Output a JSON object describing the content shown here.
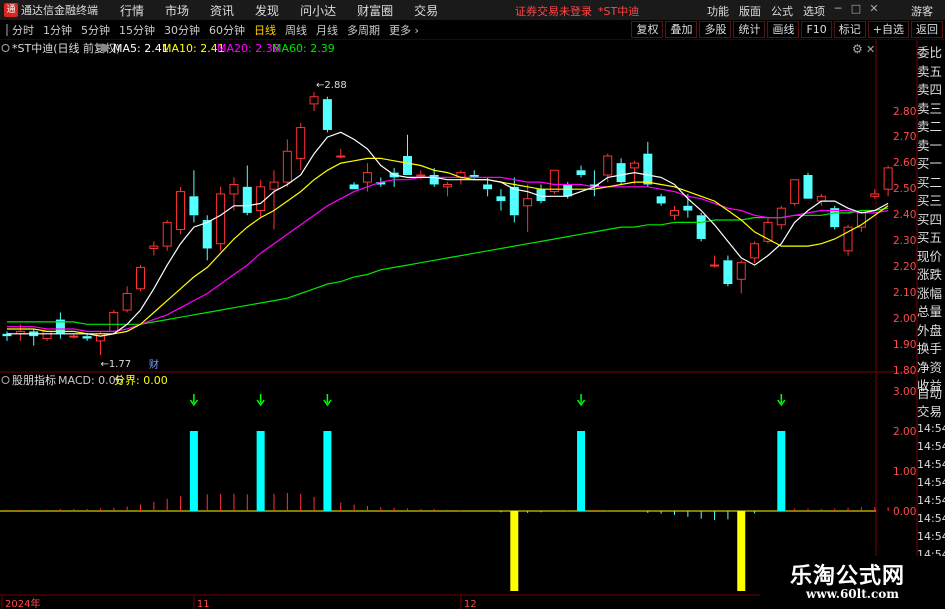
{
  "app": {
    "name": "通达信金融终端",
    "logo_char": "通"
  },
  "menu": [
    "行情",
    "市场",
    "资讯",
    "发现",
    "问小达",
    "财富圈",
    "交易"
  ],
  "login_warning": {
    "text": "证券交易未登录",
    "stock": "*ST中迪"
  },
  "right_menu": [
    "功能",
    "版面",
    "公式",
    "选项"
  ],
  "guest_label": "游客",
  "periods": [
    {
      "label": "分时",
      "active": false
    },
    {
      "label": "1分钟",
      "active": false
    },
    {
      "label": "5分钟",
      "active": false
    },
    {
      "label": "15分钟",
      "active": false
    },
    {
      "label": "30分钟",
      "active": false
    },
    {
      "label": "60分钟",
      "active": false
    },
    {
      "label": "日线",
      "active": true
    },
    {
      "label": "周线",
      "active": false
    },
    {
      "label": "月线",
      "active": false
    },
    {
      "label": "多周期",
      "active": false
    },
    {
      "label": "更多",
      "active": false
    }
  ],
  "tools": [
    "复权",
    "叠加",
    "多股",
    "统计",
    "画线",
    "F10",
    "标记",
    "+自选",
    "返回"
  ],
  "side_panel": [
    "委比",
    "卖五",
    "卖四",
    "卖三",
    "卖二",
    "卖一",
    "买一",
    "买二",
    "买三",
    "买四",
    "买五",
    "现价",
    "涨跌",
    "涨幅",
    "总量",
    "外盘",
    "换手",
    "净资",
    "收益"
  ],
  "auto_trade": [
    "自动",
    "交易"
  ],
  "watermark": {
    "title": "乐淘公式网",
    "url": "www.60lt.com"
  },
  "colors": {
    "up": "#ff3232",
    "down": "#54ffff",
    "ma5": "#ffffff",
    "ma10": "#ffff00",
    "ma20": "#ff00ff",
    "ma60": "#00e600",
    "macd_pos": "#00ffff",
    "macd_neg": "#ffff00",
    "frame": "#7a0000",
    "arrow": "#00ff00"
  },
  "chart_data": [
    {
      "type": "candlestick",
      "title": "*ST中迪(日线 前复权)",
      "ma_legend": [
        {
          "label": "MA5: 2.41",
          "color": "#ffffff"
        },
        {
          "label": "MA10: 2.41",
          "color": "#ffff00"
        },
        {
          "label": "MA20: 2.38",
          "color": "#ff00ff"
        },
        {
          "label": "MA60: 2.39",
          "color": "#00e600"
        }
      ],
      "ylim": [
        1.75,
        2.95
      ],
      "y_ticks": [
        "2.80",
        "2.70",
        "2.60",
        "2.50",
        "2.40",
        "2.30",
        "2.20",
        "2.10",
        "2.00",
        "1.90",
        "1.80"
      ],
      "annotations": [
        {
          "text": "2.88",
          "index": 23,
          "price": 2.88
        },
        {
          "text": "1.77",
          "index": 7,
          "price": 1.83
        },
        {
          "text": "财",
          "index": 11,
          "price": 1.8
        }
      ],
      "x_labels": [
        {
          "text": "2024年",
          "index": 0
        },
        {
          "text": "11",
          "index": 14
        },
        {
          "text": "12",
          "index": 34
        }
      ],
      "candles": [
        {
          "o": 1.86,
          "h": 1.87,
          "l": 1.83,
          "c": 1.85
        },
        {
          "o": 1.86,
          "h": 1.9,
          "l": 1.83,
          "c": 1.87
        },
        {
          "o": 1.87,
          "h": 1.88,
          "l": 1.81,
          "c": 1.85
        },
        {
          "o": 1.84,
          "h": 1.87,
          "l": 1.83,
          "c": 1.87
        },
        {
          "o": 1.92,
          "h": 1.95,
          "l": 1.84,
          "c": 1.86
        },
        {
          "o": 1.85,
          "h": 1.86,
          "l": 1.84,
          "c": 1.85
        },
        {
          "o": 1.85,
          "h": 1.86,
          "l": 1.83,
          "c": 1.84
        },
        {
          "o": 1.83,
          "h": 1.87,
          "l": 1.77,
          "c": 1.86
        },
        {
          "o": 1.87,
          "h": 1.96,
          "l": 1.86,
          "c": 1.95
        },
        {
          "o": 1.96,
          "h": 2.06,
          "l": 1.95,
          "c": 2.03
        },
        {
          "o": 2.05,
          "h": 2.15,
          "l": 2.04,
          "c": 2.14
        },
        {
          "o": 2.22,
          "h": 2.25,
          "l": 2.19,
          "c": 2.23
        },
        {
          "o": 2.23,
          "h": 2.34,
          "l": 2.21,
          "c": 2.33
        },
        {
          "o": 2.3,
          "h": 2.48,
          "l": 2.28,
          "c": 2.46
        },
        {
          "o": 2.44,
          "h": 2.55,
          "l": 2.33,
          "c": 2.36
        },
        {
          "o": 2.34,
          "h": 2.36,
          "l": 2.17,
          "c": 2.22
        },
        {
          "o": 2.24,
          "h": 2.48,
          "l": 2.21,
          "c": 2.45
        },
        {
          "o": 2.45,
          "h": 2.52,
          "l": 2.38,
          "c": 2.49
        },
        {
          "o": 2.48,
          "h": 2.57,
          "l": 2.36,
          "c": 2.37
        },
        {
          "o": 2.38,
          "h": 2.51,
          "l": 2.35,
          "c": 2.48
        },
        {
          "o": 2.47,
          "h": 2.55,
          "l": 2.3,
          "c": 2.5
        },
        {
          "o": 2.5,
          "h": 2.68,
          "l": 2.48,
          "c": 2.63
        },
        {
          "o": 2.6,
          "h": 2.75,
          "l": 2.55,
          "c": 2.73
        },
        {
          "o": 2.83,
          "h": 2.88,
          "l": 2.8,
          "c": 2.86
        },
        {
          "o": 2.85,
          "h": 2.86,
          "l": 2.71,
          "c": 2.72
        },
        {
          "o": 2.61,
          "h": 2.64,
          "l": 2.6,
          "c": 2.61
        },
        {
          "o": 2.49,
          "h": 2.5,
          "l": 2.47,
          "c": 2.47
        },
        {
          "o": 2.5,
          "h": 2.58,
          "l": 2.46,
          "c": 2.54
        },
        {
          "o": 2.5,
          "h": 2.52,
          "l": 2.48,
          "c": 2.49
        },
        {
          "o": 2.54,
          "h": 2.56,
          "l": 2.48,
          "c": 2.52
        },
        {
          "o": 2.61,
          "h": 2.7,
          "l": 2.55,
          "c": 2.53
        },
        {
          "o": 2.53,
          "h": 2.55,
          "l": 2.51,
          "c": 2.53
        },
        {
          "o": 2.53,
          "h": 2.56,
          "l": 2.48,
          "c": 2.49
        },
        {
          "o": 2.48,
          "h": 2.5,
          "l": 2.44,
          "c": 2.49
        },
        {
          "o": 2.52,
          "h": 2.55,
          "l": 2.49,
          "c": 2.54
        },
        {
          "o": 2.53,
          "h": 2.55,
          "l": 2.51,
          "c": 2.52
        },
        {
          "o": 2.49,
          "h": 2.52,
          "l": 2.44,
          "c": 2.47
        },
        {
          "o": 2.44,
          "h": 2.47,
          "l": 2.38,
          "c": 2.42
        },
        {
          "o": 2.48,
          "h": 2.52,
          "l": 2.33,
          "c": 2.36
        },
        {
          "o": 2.4,
          "h": 2.49,
          "l": 2.29,
          "c": 2.43
        },
        {
          "o": 2.47,
          "h": 2.49,
          "l": 2.41,
          "c": 2.42
        },
        {
          "o": 2.46,
          "h": 2.55,
          "l": 2.45,
          "c": 2.55
        },
        {
          "o": 2.49,
          "h": 2.5,
          "l": 2.43,
          "c": 2.44
        },
        {
          "o": 2.55,
          "h": 2.57,
          "l": 2.52,
          "c": 2.53
        },
        {
          "o": 2.49,
          "h": 2.55,
          "l": 2.44,
          "c": 2.48
        },
        {
          "o": 2.53,
          "h": 2.62,
          "l": 2.5,
          "c": 2.61
        },
        {
          "o": 2.58,
          "h": 2.6,
          "l": 2.49,
          "c": 2.5
        },
        {
          "o": 2.56,
          "h": 2.59,
          "l": 2.49,
          "c": 2.58
        },
        {
          "o": 2.62,
          "h": 2.67,
          "l": 2.48,
          "c": 2.49
        },
        {
          "o": 2.44,
          "h": 2.45,
          "l": 2.4,
          "c": 2.41
        },
        {
          "o": 2.36,
          "h": 2.4,
          "l": 2.34,
          "c": 2.38
        },
        {
          "o": 2.4,
          "h": 2.45,
          "l": 2.35,
          "c": 2.38
        },
        {
          "o": 2.36,
          "h": 2.37,
          "l": 2.25,
          "c": 2.26
        },
        {
          "o": 2.15,
          "h": 2.19,
          "l": 2.14,
          "c": 2.15
        },
        {
          "o": 2.17,
          "h": 2.19,
          "l": 2.06,
          "c": 2.07
        },
        {
          "o": 2.09,
          "h": 2.17,
          "l": 2.03,
          "c": 2.16
        },
        {
          "o": 2.18,
          "h": 2.25,
          "l": 2.16,
          "c": 2.24
        },
        {
          "o": 2.25,
          "h": 2.35,
          "l": 2.24,
          "c": 2.33
        },
        {
          "o": 2.32,
          "h": 2.4,
          "l": 2.3,
          "c": 2.39
        },
        {
          "o": 2.41,
          "h": 2.51,
          "l": 2.4,
          "c": 2.51
        },
        {
          "o": 2.53,
          "h": 2.54,
          "l": 2.43,
          "c": 2.43
        },
        {
          "o": 2.42,
          "h": 2.45,
          "l": 2.4,
          "c": 2.44
        },
        {
          "o": 2.39,
          "h": 2.4,
          "l": 2.3,
          "c": 2.31
        },
        {
          "o": 2.21,
          "h": 2.32,
          "l": 2.19,
          "c": 2.31
        },
        {
          "o": 2.31,
          "h": 2.38,
          "l": 2.29,
          "c": 2.37
        },
        {
          "o": 2.44,
          "h": 2.47,
          "l": 2.43,
          "c": 2.45
        },
        {
          "o": 2.47,
          "h": 2.57,
          "l": 2.44,
          "c": 2.56
        }
      ],
      "ma": {
        "ma5": [
          1.86,
          1.86,
          1.86,
          1.86,
          1.86,
          1.86,
          1.86,
          1.85,
          1.86,
          1.9,
          1.96,
          2.05,
          2.15,
          2.24,
          2.31,
          2.33,
          2.36,
          2.4,
          2.4,
          2.41,
          2.46,
          2.49,
          2.53,
          2.62,
          2.69,
          2.71,
          2.68,
          2.64,
          2.57,
          2.53,
          2.52,
          2.52,
          2.52,
          2.51,
          2.51,
          2.51,
          2.51,
          2.5,
          2.47,
          2.46,
          2.44,
          2.44,
          2.44,
          2.46,
          2.48,
          2.52,
          2.53,
          2.54,
          2.53,
          2.52,
          2.49,
          2.43,
          2.38,
          2.32,
          2.25,
          2.18,
          2.15,
          2.19,
          2.24,
          2.33,
          2.38,
          2.42,
          2.42,
          2.39,
          2.37,
          2.38,
          2.41
        ],
        "ma10": [
          1.88,
          1.88,
          1.88,
          1.87,
          1.87,
          1.87,
          1.86,
          1.86,
          1.86,
          1.87,
          1.9,
          1.95,
          2.0,
          2.05,
          2.1,
          2.14,
          2.2,
          2.26,
          2.31,
          2.35,
          2.38,
          2.42,
          2.46,
          2.51,
          2.55,
          2.58,
          2.59,
          2.6,
          2.6,
          2.59,
          2.58,
          2.57,
          2.55,
          2.54,
          2.52,
          2.51,
          2.51,
          2.5,
          2.49,
          2.48,
          2.47,
          2.47,
          2.47,
          2.47,
          2.47,
          2.48,
          2.49,
          2.5,
          2.5,
          2.49,
          2.48,
          2.46,
          2.44,
          2.42,
          2.38,
          2.34,
          2.29,
          2.26,
          2.23,
          2.23,
          2.23,
          2.24,
          2.26,
          2.29,
          2.32,
          2.36,
          2.4
        ],
        "ma20": [
          1.89,
          1.89,
          1.89,
          1.88,
          1.88,
          1.88,
          1.87,
          1.87,
          1.87,
          1.88,
          1.9,
          1.92,
          1.94,
          1.97,
          2.0,
          2.03,
          2.07,
          2.11,
          2.15,
          2.2,
          2.24,
          2.28,
          2.32,
          2.36,
          2.4,
          2.43,
          2.46,
          2.48,
          2.5,
          2.51,
          2.51,
          2.52,
          2.52,
          2.52,
          2.52,
          2.52,
          2.52,
          2.52,
          2.51,
          2.5,
          2.5,
          2.49,
          2.49,
          2.49,
          2.48,
          2.48,
          2.48,
          2.48,
          2.48,
          2.47,
          2.46,
          2.44,
          2.43,
          2.41,
          2.39,
          2.38,
          2.36,
          2.35,
          2.35,
          2.36,
          2.37,
          2.38,
          2.38,
          2.38,
          2.37,
          2.37,
          2.38
        ],
        "ma60": [
          1.91,
          1.91,
          1.91,
          1.91,
          1.91,
          1.91,
          1.9,
          1.9,
          1.9,
          1.9,
          1.9,
          1.91,
          1.92,
          1.93,
          1.94,
          1.95,
          1.96,
          1.97,
          1.98,
          1.99,
          2.0,
          2.01,
          2.03,
          2.05,
          2.07,
          2.08,
          2.1,
          2.11,
          2.13,
          2.14,
          2.15,
          2.16,
          2.17,
          2.18,
          2.19,
          2.2,
          2.21,
          2.22,
          2.23,
          2.24,
          2.25,
          2.26,
          2.27,
          2.28,
          2.29,
          2.3,
          2.31,
          2.31,
          2.32,
          2.32,
          2.33,
          2.33,
          2.33,
          2.34,
          2.34,
          2.34,
          2.35,
          2.35,
          2.35,
          2.36,
          2.36,
          2.36,
          2.37,
          2.37,
          2.38,
          2.38,
          2.39
        ]
      }
    },
    {
      "type": "bar",
      "title": "股朋指标",
      "legend": [
        {
          "label": "MACD: 0.06",
          "color": "#c8c8c8"
        },
        {
          "label": "分界: 0.00",
          "color": "#ffff00"
        }
      ],
      "ylim": [
        -2.0,
        3.0
      ],
      "y_ticks": [
        "3.00",
        "2.00",
        "1.00",
        "0.00"
      ],
      "signals": [
        {
          "index": 14,
          "value": 2.0
        },
        {
          "index": 19,
          "value": 2.0
        },
        {
          "index": 24,
          "value": 2.0
        },
        {
          "index": 43,
          "value": 2.0
        },
        {
          "index": 38,
          "value": -2.0
        },
        {
          "index": 55,
          "value": -2.0
        },
        {
          "index": 58,
          "value": 2.0
        }
      ],
      "arrows": [
        14,
        19,
        24,
        43,
        58
      ],
      "macd_stubs": [
        0.02,
        0.02,
        0.02,
        0.02,
        0.03,
        0.03,
        0.03,
        0.04,
        0.05,
        0.07,
        0.1,
        0.14,
        0.19,
        0.23,
        0.25,
        0.26,
        0.27,
        0.27,
        0.26,
        0.26,
        0.27,
        0.28,
        0.27,
        0.22,
        0.17,
        0.13,
        0.1,
        0.08,
        0.06,
        0.05,
        0.04,
        0.03,
        0.03,
        0.02,
        0.01,
        0.0,
        -0.01,
        -0.02,
        -0.03,
        -0.03,
        -0.02,
        -0.01,
        0.01,
        0.02,
        0.02,
        0.01,
        0.0,
        -0.01,
        -0.03,
        -0.04,
        -0.06,
        -0.09,
        -0.12,
        -0.14,
        -0.13,
        -0.09,
        -0.04,
        0.0,
        0.03,
        0.04,
        0.04,
        0.03,
        0.04,
        0.05,
        0.06,
        0.06,
        0.06
      ],
      "axis_labels_time": [
        "14:54",
        "14:54",
        "14:54",
        "14:54",
        "14:54",
        "14:54",
        "14:54",
        "14:54"
      ]
    }
  ]
}
